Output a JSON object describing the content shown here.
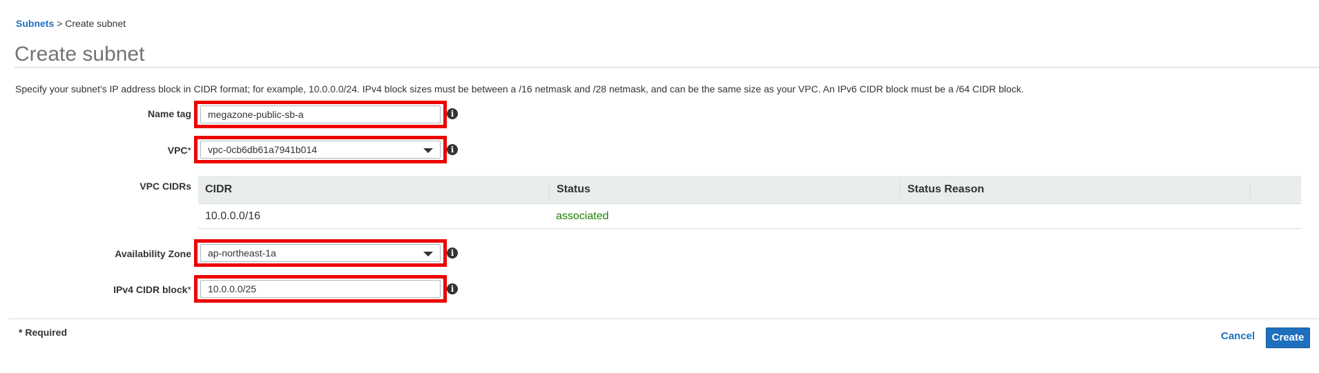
{
  "breadcrumb": {
    "parent": "Subnets",
    "separator": " > ",
    "current": "Create subnet"
  },
  "title": "Create subnet",
  "description": "Specify your subnet's IP address block in CIDR format; for example, 10.0.0.0/24. IPv4 block sizes must be between a /16 netmask and /28 netmask, and can be the same size as your VPC. An IPv6 CIDR block must be a /64 CIDR block.",
  "form": {
    "name_tag": {
      "label": "Name tag",
      "value": "megazone-public-sb-a"
    },
    "vpc": {
      "label": "VPC",
      "required_mark": "*",
      "value": "vpc-0cb6db61a7941b014"
    },
    "vpc_cidrs": {
      "label": "VPC CIDRs",
      "columns": [
        "CIDR",
        "Status",
        "Status Reason"
      ],
      "rows": [
        {
          "cidr": "10.0.0.0/16",
          "status": "associated",
          "reason": ""
        }
      ]
    },
    "availability_zone": {
      "label": "Availability Zone",
      "value": "ap-northeast-1a"
    },
    "ipv4_cidr": {
      "label": "IPv4 CIDR block",
      "required_mark": "*",
      "value": "10.0.0.0/25"
    }
  },
  "footer": {
    "required_note": "* Required",
    "cancel_label": "Cancel",
    "create_label": "Create"
  },
  "icons": {
    "info": "info-icon",
    "dropdown": "caret-down-icon"
  },
  "colors": {
    "link": "#1f6fbf",
    "primary_button": "#1f6fbf",
    "highlight": "#ee0000",
    "status_ok": "#1d8102"
  }
}
